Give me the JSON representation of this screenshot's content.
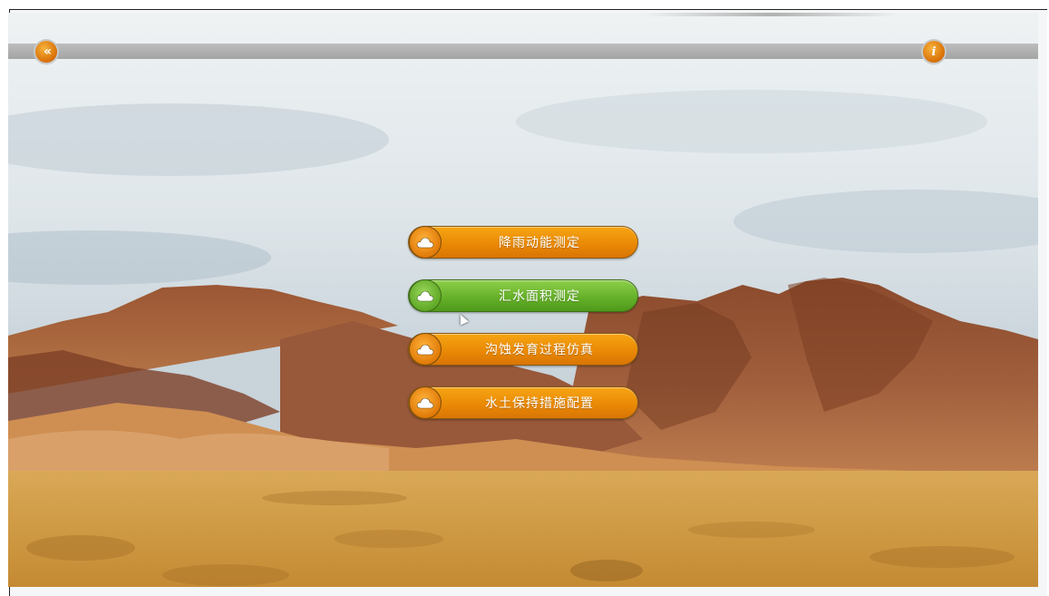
{
  "nav": {
    "back_icon": "double-chevron-left-icon",
    "back_glyph": "«",
    "info_icon": "info-icon",
    "info_glyph": "i",
    "accent_color": "#e8860a"
  },
  "menu": {
    "items": [
      {
        "label": "降雨动能测定",
        "icon": "cloud-icon",
        "state": "normal"
      },
      {
        "label": "汇水面积测定",
        "icon": "cloud-icon",
        "state": "hover"
      },
      {
        "label": "沟蚀发育过程仿真",
        "icon": "cloud-icon",
        "state": "normal"
      },
      {
        "label": "水土保持措施配置",
        "icon": "cloud-icon",
        "state": "normal"
      }
    ],
    "normal_color": "#ea8a05",
    "hover_color": "#66b12a"
  }
}
